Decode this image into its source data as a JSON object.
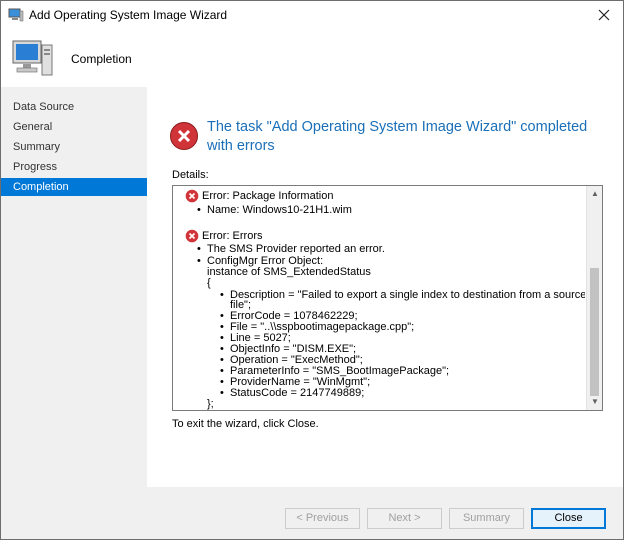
{
  "window": {
    "title": "Add Operating System Image Wizard"
  },
  "header": {
    "title": "Completion"
  },
  "nav": {
    "items": [
      {
        "label": "Data Source"
      },
      {
        "label": "General"
      },
      {
        "label": "Summary"
      },
      {
        "label": "Progress"
      },
      {
        "label": "Completion",
        "active": true
      }
    ]
  },
  "main": {
    "result_title": "The task \"Add Operating System Image Wizard\" completed with errors",
    "details_label": "Details:",
    "details": {
      "error1_header": "Error: Package Information",
      "error1_name": "Name: Windows10-21H1.wim",
      "error2_header": "Error: Errors",
      "error2_line1": "The SMS Provider reported an error.",
      "error2_line2": "ConfigMgr Error Object:",
      "error2_line3": "instance of SMS_ExtendedStatus",
      "open_brace": "{",
      "props": [
        "Description = \"Failed to export a single index to destination from a source WIM",
        "file\";",
        "ErrorCode = 1078462229;",
        "File = \"..\\\\sspbootimagepackage.cpp\";",
        "Line = 5027;",
        "ObjectInfo = \"DISM.EXE\";",
        "Operation = \"ExecMethod\";",
        "ParameterInfo = \"SMS_BootImagePackage\";",
        "ProviderName = \"WinMgmt\";",
        "StatusCode = 2147749889;"
      ],
      "close_brace": "};"
    },
    "exit_text": "To exit the wizard, click Close."
  },
  "footer": {
    "previous": "< Previous",
    "next": "Next >",
    "summary": "Summary",
    "close": "Close"
  },
  "colors": {
    "accent": "#0078d7",
    "title_blue": "#1a6fb8",
    "error_red": "#d13438"
  }
}
